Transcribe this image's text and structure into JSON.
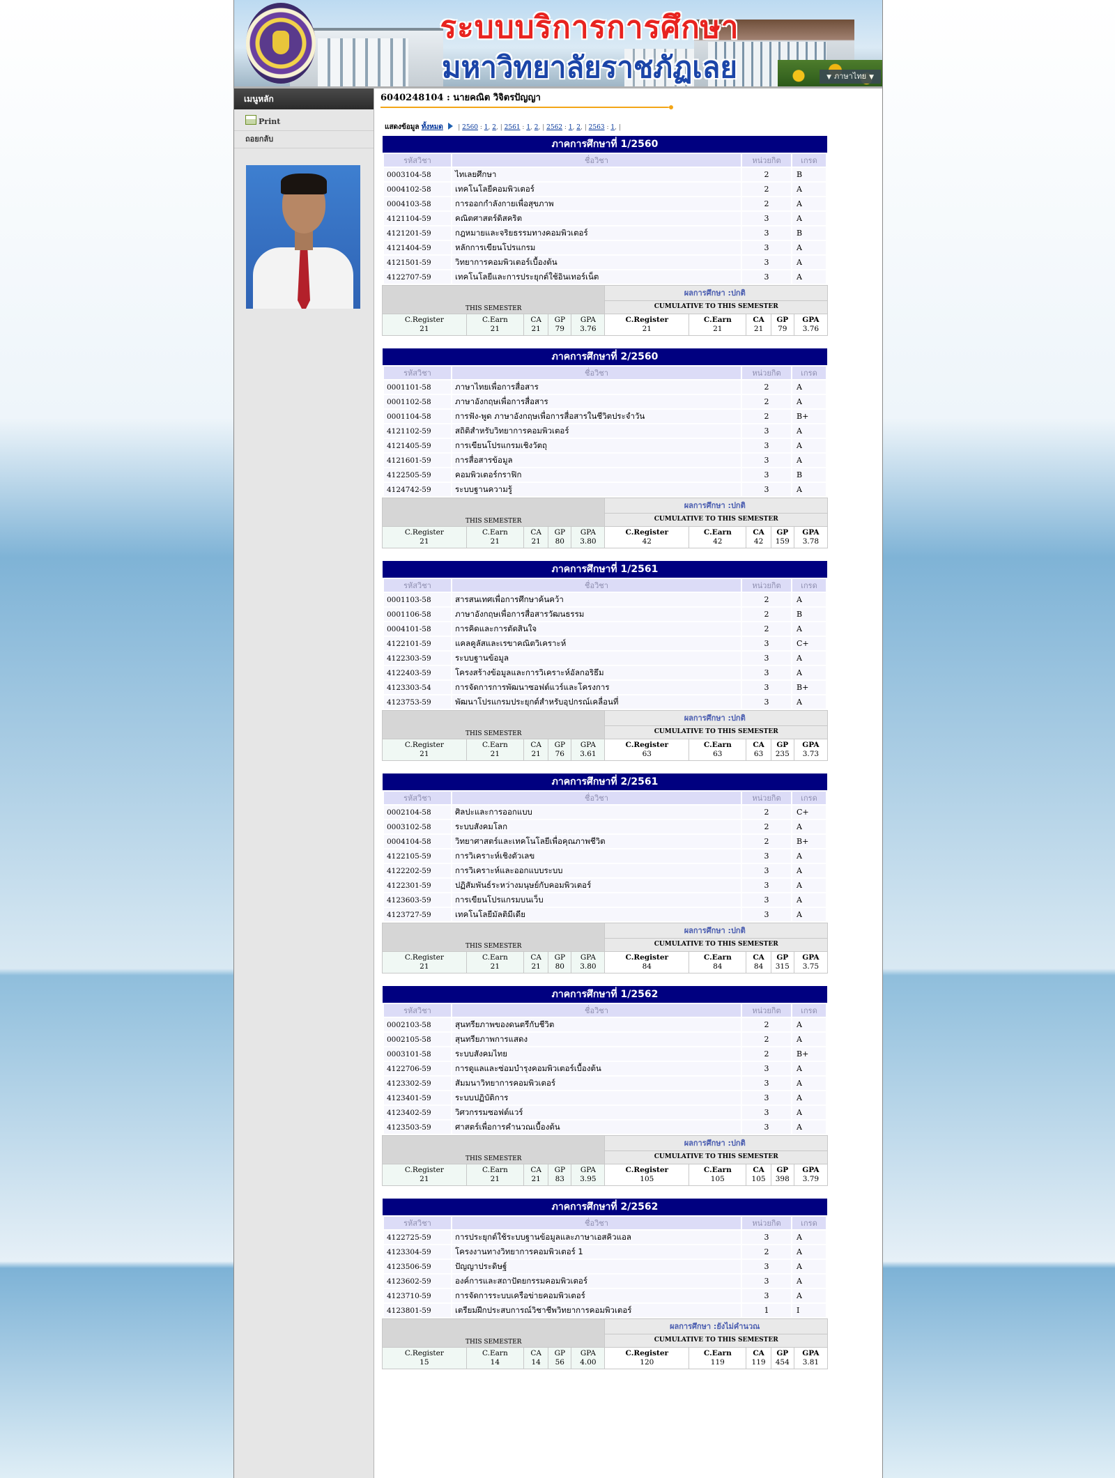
{
  "header": {
    "title_line1": "ระบบบริการการศึกษา",
    "title_line2": "มหาวิทยาลัยราชภัฏเลย",
    "language": "ภาษาไทย"
  },
  "sidebar": {
    "menu_title": "เมนูหลัก",
    "items": [
      {
        "label": "Print",
        "icon": "printer-icon"
      },
      {
        "label": "ถอยกลับ"
      }
    ]
  },
  "student": {
    "heading": "6040248104 : นายคณิต วิจิตรปัญญา"
  },
  "filter": {
    "label": "แสดงข้อมูล",
    "all_label": "ทั้งหมด",
    "years": [
      {
        "year": "2560",
        "terms": [
          "1",
          "2"
        ]
      },
      {
        "year": "2561",
        "terms": [
          "1",
          "2"
        ]
      },
      {
        "year": "2562",
        "terms": [
          "1",
          "2"
        ]
      },
      {
        "year": "2563",
        "terms": [
          "1"
        ]
      }
    ]
  },
  "columns": {
    "code": "รหัสวิชา",
    "name": "ชื่อวิชา",
    "credits": "หน่วยกิต",
    "grade": "เกรด"
  },
  "summary_labels": {
    "result_prefix": "ผลการศึกษา :",
    "this_semester": "THIS SEMESTER",
    "cumulative": "CUMULATIVE TO THIS SEMESTER",
    "c_register": "C.Register",
    "c_earn": "C.Earn",
    "ca": "CA",
    "gp": "GP",
    "gpa": "GPA"
  },
  "semesters": [
    {
      "title": "ภาคการศึกษาที่ 1/2560",
      "courses": [
        {
          "code": "0003104-58",
          "name": "ไทเลยศึกษา",
          "credits": "2",
          "grade": "B"
        },
        {
          "code": "0004102-58",
          "name": "เทคโนโลยีคอมพิวเตอร์",
          "credits": "2",
          "grade": "A"
        },
        {
          "code": "0004103-58",
          "name": "การออกกำลังกายเพื่อสุขภาพ",
          "credits": "2",
          "grade": "A"
        },
        {
          "code": "4121104-59",
          "name": "คณิตศาสตร์ดิสคริต",
          "credits": "3",
          "grade": "A"
        },
        {
          "code": "4121201-59",
          "name": "กฎหมายและจริยธรรมทางคอมพิวเตอร์",
          "credits": "3",
          "grade": "B"
        },
        {
          "code": "4121404-59",
          "name": "หลักการเขียนโปรแกรม",
          "credits": "3",
          "grade": "A"
        },
        {
          "code": "4121501-59",
          "name": "วิทยาการคอมพิวเตอร์เบื้องต้น",
          "credits": "3",
          "grade": "A"
        },
        {
          "code": "4122707-59",
          "name": "เทคโนโลยีและการประยุกต์ใช้อินเทอร์เน็ต",
          "credits": "3",
          "grade": "A"
        }
      ],
      "result": "ปกติ",
      "term": {
        "c_register": "21",
        "c_earn": "21",
        "ca": "21",
        "gp": "79",
        "gpa": "3.76"
      },
      "cumulative": {
        "c_register": "21",
        "c_earn": "21",
        "ca": "21",
        "gp": "79",
        "gpa": "3.76"
      }
    },
    {
      "title": "ภาคการศึกษาที่ 2/2560",
      "courses": [
        {
          "code": "0001101-58",
          "name": "ภาษาไทยเพื่อการสื่อสาร",
          "credits": "2",
          "grade": "A"
        },
        {
          "code": "0001102-58",
          "name": "ภาษาอังกฤษเพื่อการสื่อสาร",
          "credits": "2",
          "grade": "A"
        },
        {
          "code": "0001104-58",
          "name": "การฟัง-พูด ภาษาอังกฤษเพื่อการสื่อสารในชีวิตประจำวัน",
          "credits": "2",
          "grade": "B+"
        },
        {
          "code": "4121102-59",
          "name": "สถิติสำหรับวิทยาการคอมพิวเตอร์",
          "credits": "3",
          "grade": "A"
        },
        {
          "code": "4121405-59",
          "name": "การเขียนโปรแกรมเชิงวัตถุ",
          "credits": "3",
          "grade": "A"
        },
        {
          "code": "4121601-59",
          "name": "การสื่อสารข้อมูล",
          "credits": "3",
          "grade": "A"
        },
        {
          "code": "4122505-59",
          "name": "คอมพิวเตอร์กราฟิก",
          "credits": "3",
          "grade": "B"
        },
        {
          "code": "4124742-59",
          "name": "ระบบฐานความรู้",
          "credits": "3",
          "grade": "A"
        }
      ],
      "result": "ปกติ",
      "term": {
        "c_register": "21",
        "c_earn": "21",
        "ca": "21",
        "gp": "80",
        "gpa": "3.80"
      },
      "cumulative": {
        "c_register": "42",
        "c_earn": "42",
        "ca": "42",
        "gp": "159",
        "gpa": "3.78"
      }
    },
    {
      "title": "ภาคการศึกษาที่ 1/2561",
      "courses": [
        {
          "code": "0001103-58",
          "name": "สารสนเทศเพื่อการศึกษาค้นคว้า",
          "credits": "2",
          "grade": "A"
        },
        {
          "code": "0001106-58",
          "name": "ภาษาอังกฤษเพื่อการสื่อสารวัฒนธรรม",
          "credits": "2",
          "grade": "B"
        },
        {
          "code": "0004101-58",
          "name": "การคิดและการตัดสินใจ",
          "credits": "2",
          "grade": "A"
        },
        {
          "code": "4122101-59",
          "name": "แคลคูลัสและเรขาคณิตวิเคราะห์",
          "credits": "3",
          "grade": "C+"
        },
        {
          "code": "4122303-59",
          "name": "ระบบฐานข้อมูล",
          "credits": "3",
          "grade": "A"
        },
        {
          "code": "4122403-59",
          "name": "โครงสร้างข้อมูลและการวิเคราะห์อัลกอริธึม",
          "credits": "3",
          "grade": "A"
        },
        {
          "code": "4123303-54",
          "name": "การจัดการการพัฒนาซอฟต์แวร์และโครงการ",
          "credits": "3",
          "grade": "B+"
        },
        {
          "code": "4123753-59",
          "name": "พัฒนาโปรแกรมประยุกต์สำหรับอุปกรณ์เคลื่อนที่",
          "credits": "3",
          "grade": "A"
        }
      ],
      "result": "ปกติ",
      "term": {
        "c_register": "21",
        "c_earn": "21",
        "ca": "21",
        "gp": "76",
        "gpa": "3.61"
      },
      "cumulative": {
        "c_register": "63",
        "c_earn": "63",
        "ca": "63",
        "gp": "235",
        "gpa": "3.73"
      }
    },
    {
      "title": "ภาคการศึกษาที่ 2/2561",
      "courses": [
        {
          "code": "0002104-58",
          "name": "ศิลปะและการออกแบบ",
          "credits": "2",
          "grade": "C+"
        },
        {
          "code": "0003102-58",
          "name": "ระบบสังคมโลก",
          "credits": "2",
          "grade": "A"
        },
        {
          "code": "0004104-58",
          "name": "วิทยาศาสตร์และเทคโนโลยีเพื่อคุณภาพชีวิต",
          "credits": "2",
          "grade": "B+"
        },
        {
          "code": "4122105-59",
          "name": "การวิเคราะห์เชิงตัวเลข",
          "credits": "3",
          "grade": "A"
        },
        {
          "code": "4122202-59",
          "name": "การวิเคราะห์และออกแบบระบบ",
          "credits": "3",
          "grade": "A"
        },
        {
          "code": "4122301-59",
          "name": "ปฏิสัมพันธ์ระหว่างมนุษย์กับคอมพิวเตอร์",
          "credits": "3",
          "grade": "A"
        },
        {
          "code": "4123603-59",
          "name": "การเขียนโปรแกรมบนเว็บ",
          "credits": "3",
          "grade": "A"
        },
        {
          "code": "4123727-59",
          "name": "เทคโนโลยีมัลติมีเดีย",
          "credits": "3",
          "grade": "A"
        }
      ],
      "result": "ปกติ",
      "term": {
        "c_register": "21",
        "c_earn": "21",
        "ca": "21",
        "gp": "80",
        "gpa": "3.80"
      },
      "cumulative": {
        "c_register": "84",
        "c_earn": "84",
        "ca": "84",
        "gp": "315",
        "gpa": "3.75"
      }
    },
    {
      "title": "ภาคการศึกษาที่ 1/2562",
      "courses": [
        {
          "code": "0002103-58",
          "name": "สุนทรียภาพของดนตรีกับชีวิต",
          "credits": "2",
          "grade": "A"
        },
        {
          "code": "0002105-58",
          "name": "สุนทรียภาพการแสดง",
          "credits": "2",
          "grade": "A"
        },
        {
          "code": "0003101-58",
          "name": "ระบบสังคมไทย",
          "credits": "2",
          "grade": "B+"
        },
        {
          "code": "4122706-59",
          "name": "การดูแลและซ่อมบำรุงคอมพิวเตอร์เบื้องต้น",
          "credits": "3",
          "grade": "A"
        },
        {
          "code": "4123302-59",
          "name": "สัมมนาวิทยาการคอมพิวเตอร์",
          "credits": "3",
          "grade": "A"
        },
        {
          "code": "4123401-59",
          "name": "ระบบปฏิบัติการ",
          "credits": "3",
          "grade": "A"
        },
        {
          "code": "4123402-59",
          "name": "วิศวกรรมซอฟต์แวร์",
          "credits": "3",
          "grade": "A"
        },
        {
          "code": "4123503-59",
          "name": "ศาสตร์เพื่อการคำนวณเบื้องต้น",
          "credits": "3",
          "grade": "A"
        }
      ],
      "result": "ปกติ",
      "term": {
        "c_register": "21",
        "c_earn": "21",
        "ca": "21",
        "gp": "83",
        "gpa": "3.95"
      },
      "cumulative": {
        "c_register": "105",
        "c_earn": "105",
        "ca": "105",
        "gp": "398",
        "gpa": "3.79"
      }
    },
    {
      "title": "ภาคการศึกษาที่ 2/2562",
      "courses": [
        {
          "code": "4122725-59",
          "name": "การประยุกต์ใช้ระบบฐานข้อมูลและภาษาเอสคิวแอล",
          "credits": "3",
          "grade": "A"
        },
        {
          "code": "4123304-59",
          "name": "โครงงานทางวิทยาการคอมพิวเตอร์ 1",
          "credits": "2",
          "grade": "A"
        },
        {
          "code": "4123506-59",
          "name": "ปัญญาประดิษฐ์",
          "credits": "3",
          "grade": "A"
        },
        {
          "code": "4123602-59",
          "name": "องค์การและสถาปัตยกรรมคอมพิวเตอร์",
          "credits": "3",
          "grade": "A"
        },
        {
          "code": "4123710-59",
          "name": "การจัดการระบบเครือข่ายคอมพิวเตอร์",
          "credits": "3",
          "grade": "A"
        },
        {
          "code": "4123801-59",
          "name": "เตรียมฝึกประสบการณ์วิชาชีพวิทยาการคอมพิวเตอร์",
          "credits": "1",
          "grade": "I"
        }
      ],
      "result": "ยังไม่คำนวณ",
      "term": {
        "c_register": "15",
        "c_earn": "14",
        "ca": "14",
        "gp": "56",
        "gpa": "4.00"
      },
      "cumulative": {
        "c_register": "120",
        "c_earn": "119",
        "ca": "119",
        "gp": "454",
        "gpa": "3.81"
      }
    }
  ]
}
